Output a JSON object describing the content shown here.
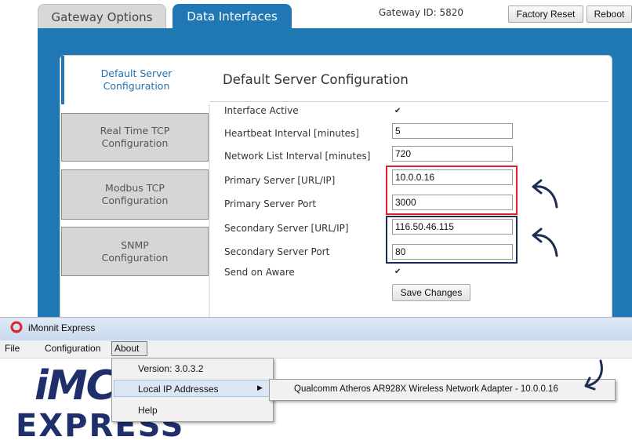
{
  "tabs": {
    "gateway_options": "Gateway Options",
    "data_interfaces": "Data Interfaces"
  },
  "gateway_id": "Gateway ID: 5820",
  "buttons": {
    "factory_reset": "Factory Reset",
    "reboot": "Reboot"
  },
  "sidebar": {
    "items": [
      {
        "line1": "Default Server",
        "line2": "Configuration"
      },
      {
        "line1": "Real Time TCP",
        "line2": "Configuration"
      },
      {
        "line1": "Modbus TCP",
        "line2": "Configuration"
      },
      {
        "line1": "SNMP",
        "line2": "Configuration"
      }
    ]
  },
  "form": {
    "title": "Default Server Configuration",
    "interface_active_label": "Interface Active",
    "heartbeat_label": "Heartbeat Interval [minutes]",
    "heartbeat_value": "5",
    "network_list_label": "Network List Interval [minutes]",
    "network_list_value": "720",
    "primary_server_label": "Primary Server [URL/IP]",
    "primary_server_value": "10.0.0.16",
    "primary_port_label": "Primary Server Port",
    "primary_port_value": "3000",
    "secondary_server_label": "Secondary Server [URL/IP]",
    "secondary_server_value": "116.50.46.115",
    "secondary_port_label": "Secondary Server Port",
    "secondary_port_value": "80",
    "send_on_aware_label": "Send on Aware",
    "save_label": "Save Changes"
  },
  "app": {
    "title": "iMonnit Express",
    "menu": {
      "file": "File",
      "configuration": "Configuration",
      "about": "About"
    },
    "about_menu": {
      "version": "Version: 3.0.3.2",
      "local_ip": "Local IP Addresses",
      "help": "Help"
    },
    "local_ip_entry": "Qualcomm Atheros AR928X Wireless Network Adapter - 10.0.0.16",
    "logo_top": "iMC",
    "logo_bottom": "EXPRESS"
  },
  "colors": {
    "accent": "#1f78b4",
    "highlight_red": "#e2202a",
    "highlight_navy": "#1d2b55",
    "annotation_arrow": "#1d2b55"
  }
}
